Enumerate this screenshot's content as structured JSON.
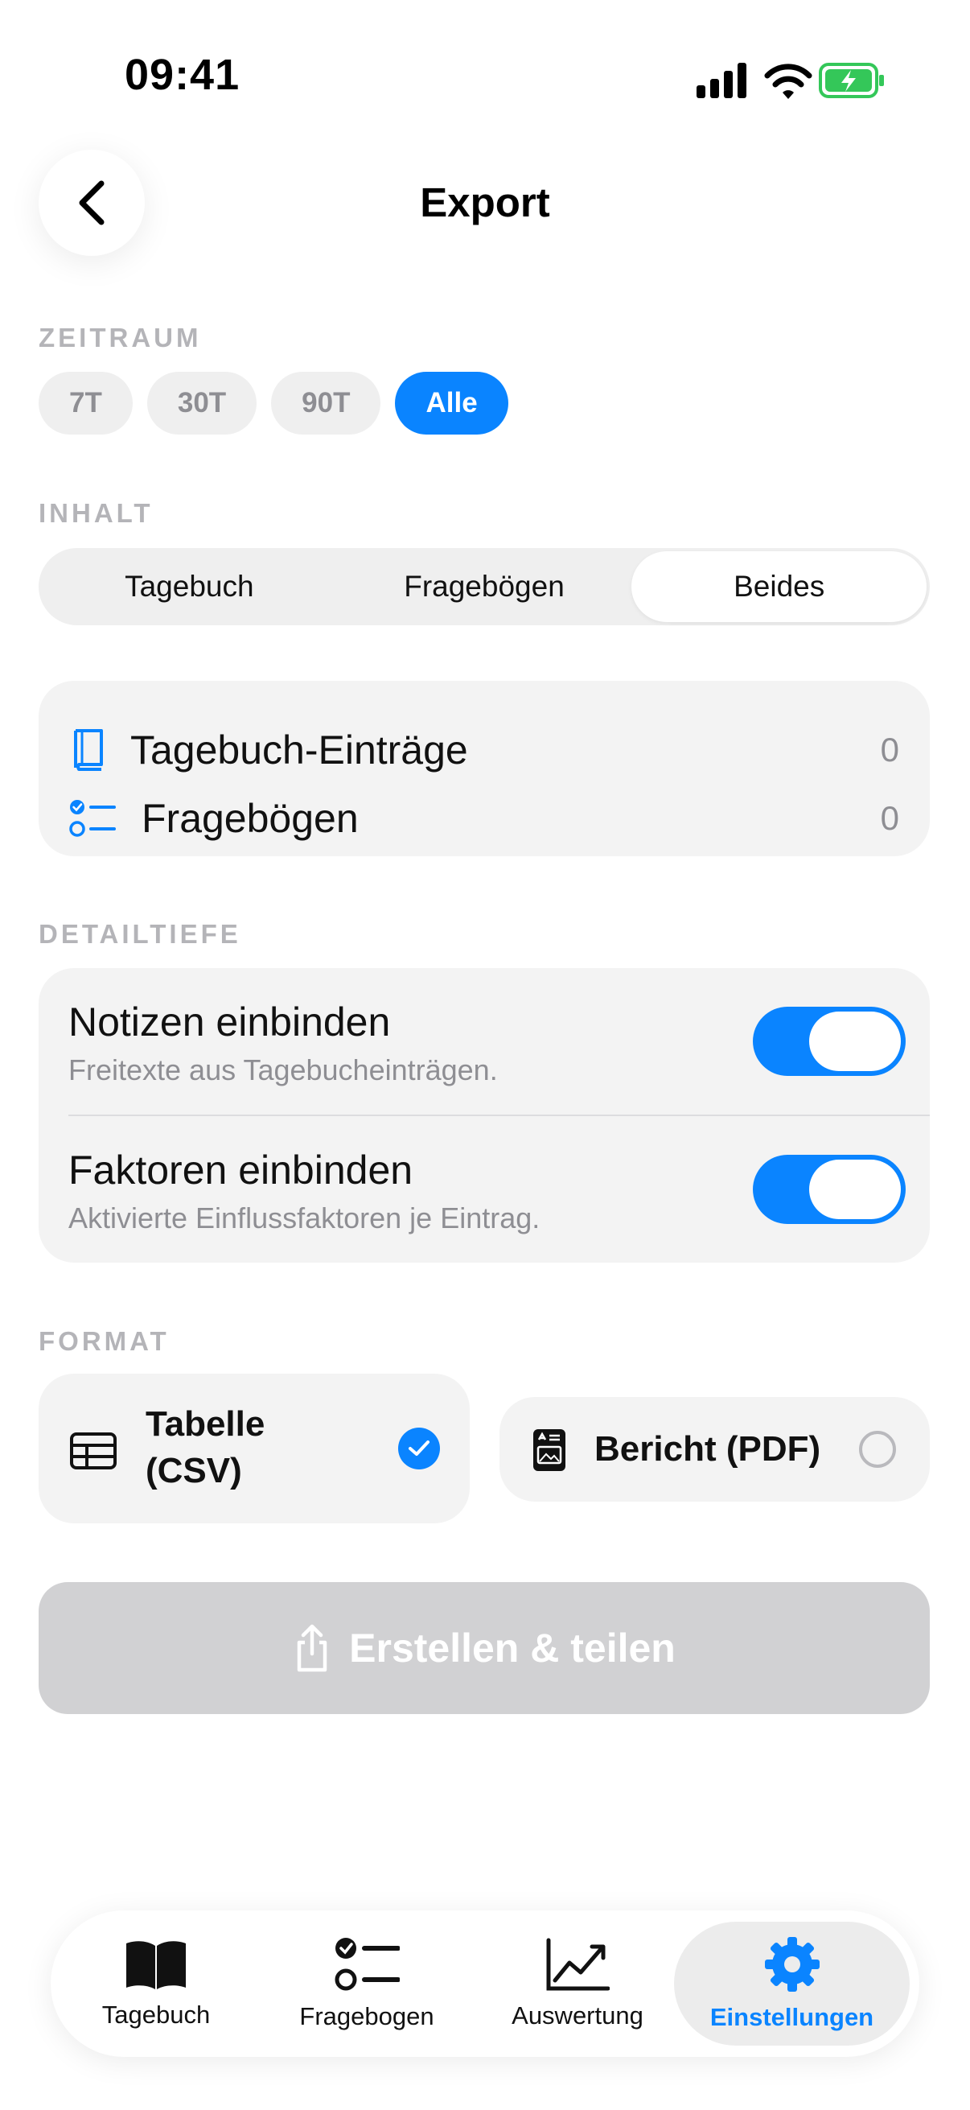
{
  "status": {
    "time": "09:41"
  },
  "header": {
    "title": "Export"
  },
  "period": {
    "label": "ZEITRAUM",
    "options": [
      "7T",
      "30T",
      "90T",
      "Alle"
    ],
    "selected": "Alle"
  },
  "content": {
    "label": "INHALT",
    "options": [
      "Tagebuch",
      "Fragebögen",
      "Beides"
    ],
    "selected": "Beides"
  },
  "counts": [
    {
      "label": "Tagebuch-Einträge",
      "value": "0",
      "icon": "book-icon"
    },
    {
      "label": "Fragebögen",
      "value": "0",
      "icon": "checklist-icon"
    }
  ],
  "detail": {
    "label": "DETAILTIEFE",
    "rows": [
      {
        "title": "Notizen einbinden",
        "subtitle": "Freitexte aus Tagebucheinträgen.",
        "on": true
      },
      {
        "title": "Faktoren einbinden",
        "subtitle": "Aktivierte Einflussfaktoren je Eintrag.",
        "on": true
      }
    ]
  },
  "format": {
    "label": "FORMAT",
    "csv": {
      "line1": "Tabelle",
      "line2": "(CSV)",
      "selected": true,
      "icon": "table-icon"
    },
    "pdf": {
      "label": "Bericht (PDF)",
      "selected": false,
      "icon": "report-icon"
    }
  },
  "action": {
    "label": "Erstellen & teilen",
    "icon": "share-icon"
  },
  "tabbar": {
    "items": [
      {
        "label": "Tagebuch",
        "icon": "book-open-icon"
      },
      {
        "label": "Fragebogen",
        "icon": "checklist-icon"
      },
      {
        "label": "Auswertung",
        "icon": "chart-line-icon"
      },
      {
        "label": "Einstellungen",
        "icon": "gear-icon"
      }
    ],
    "active": "Einstellungen"
  },
  "colors": {
    "accent": "#0a84ff",
    "card": "#f3f3f3",
    "disabled": "#d1d1d3",
    "battery": "#34c759"
  }
}
